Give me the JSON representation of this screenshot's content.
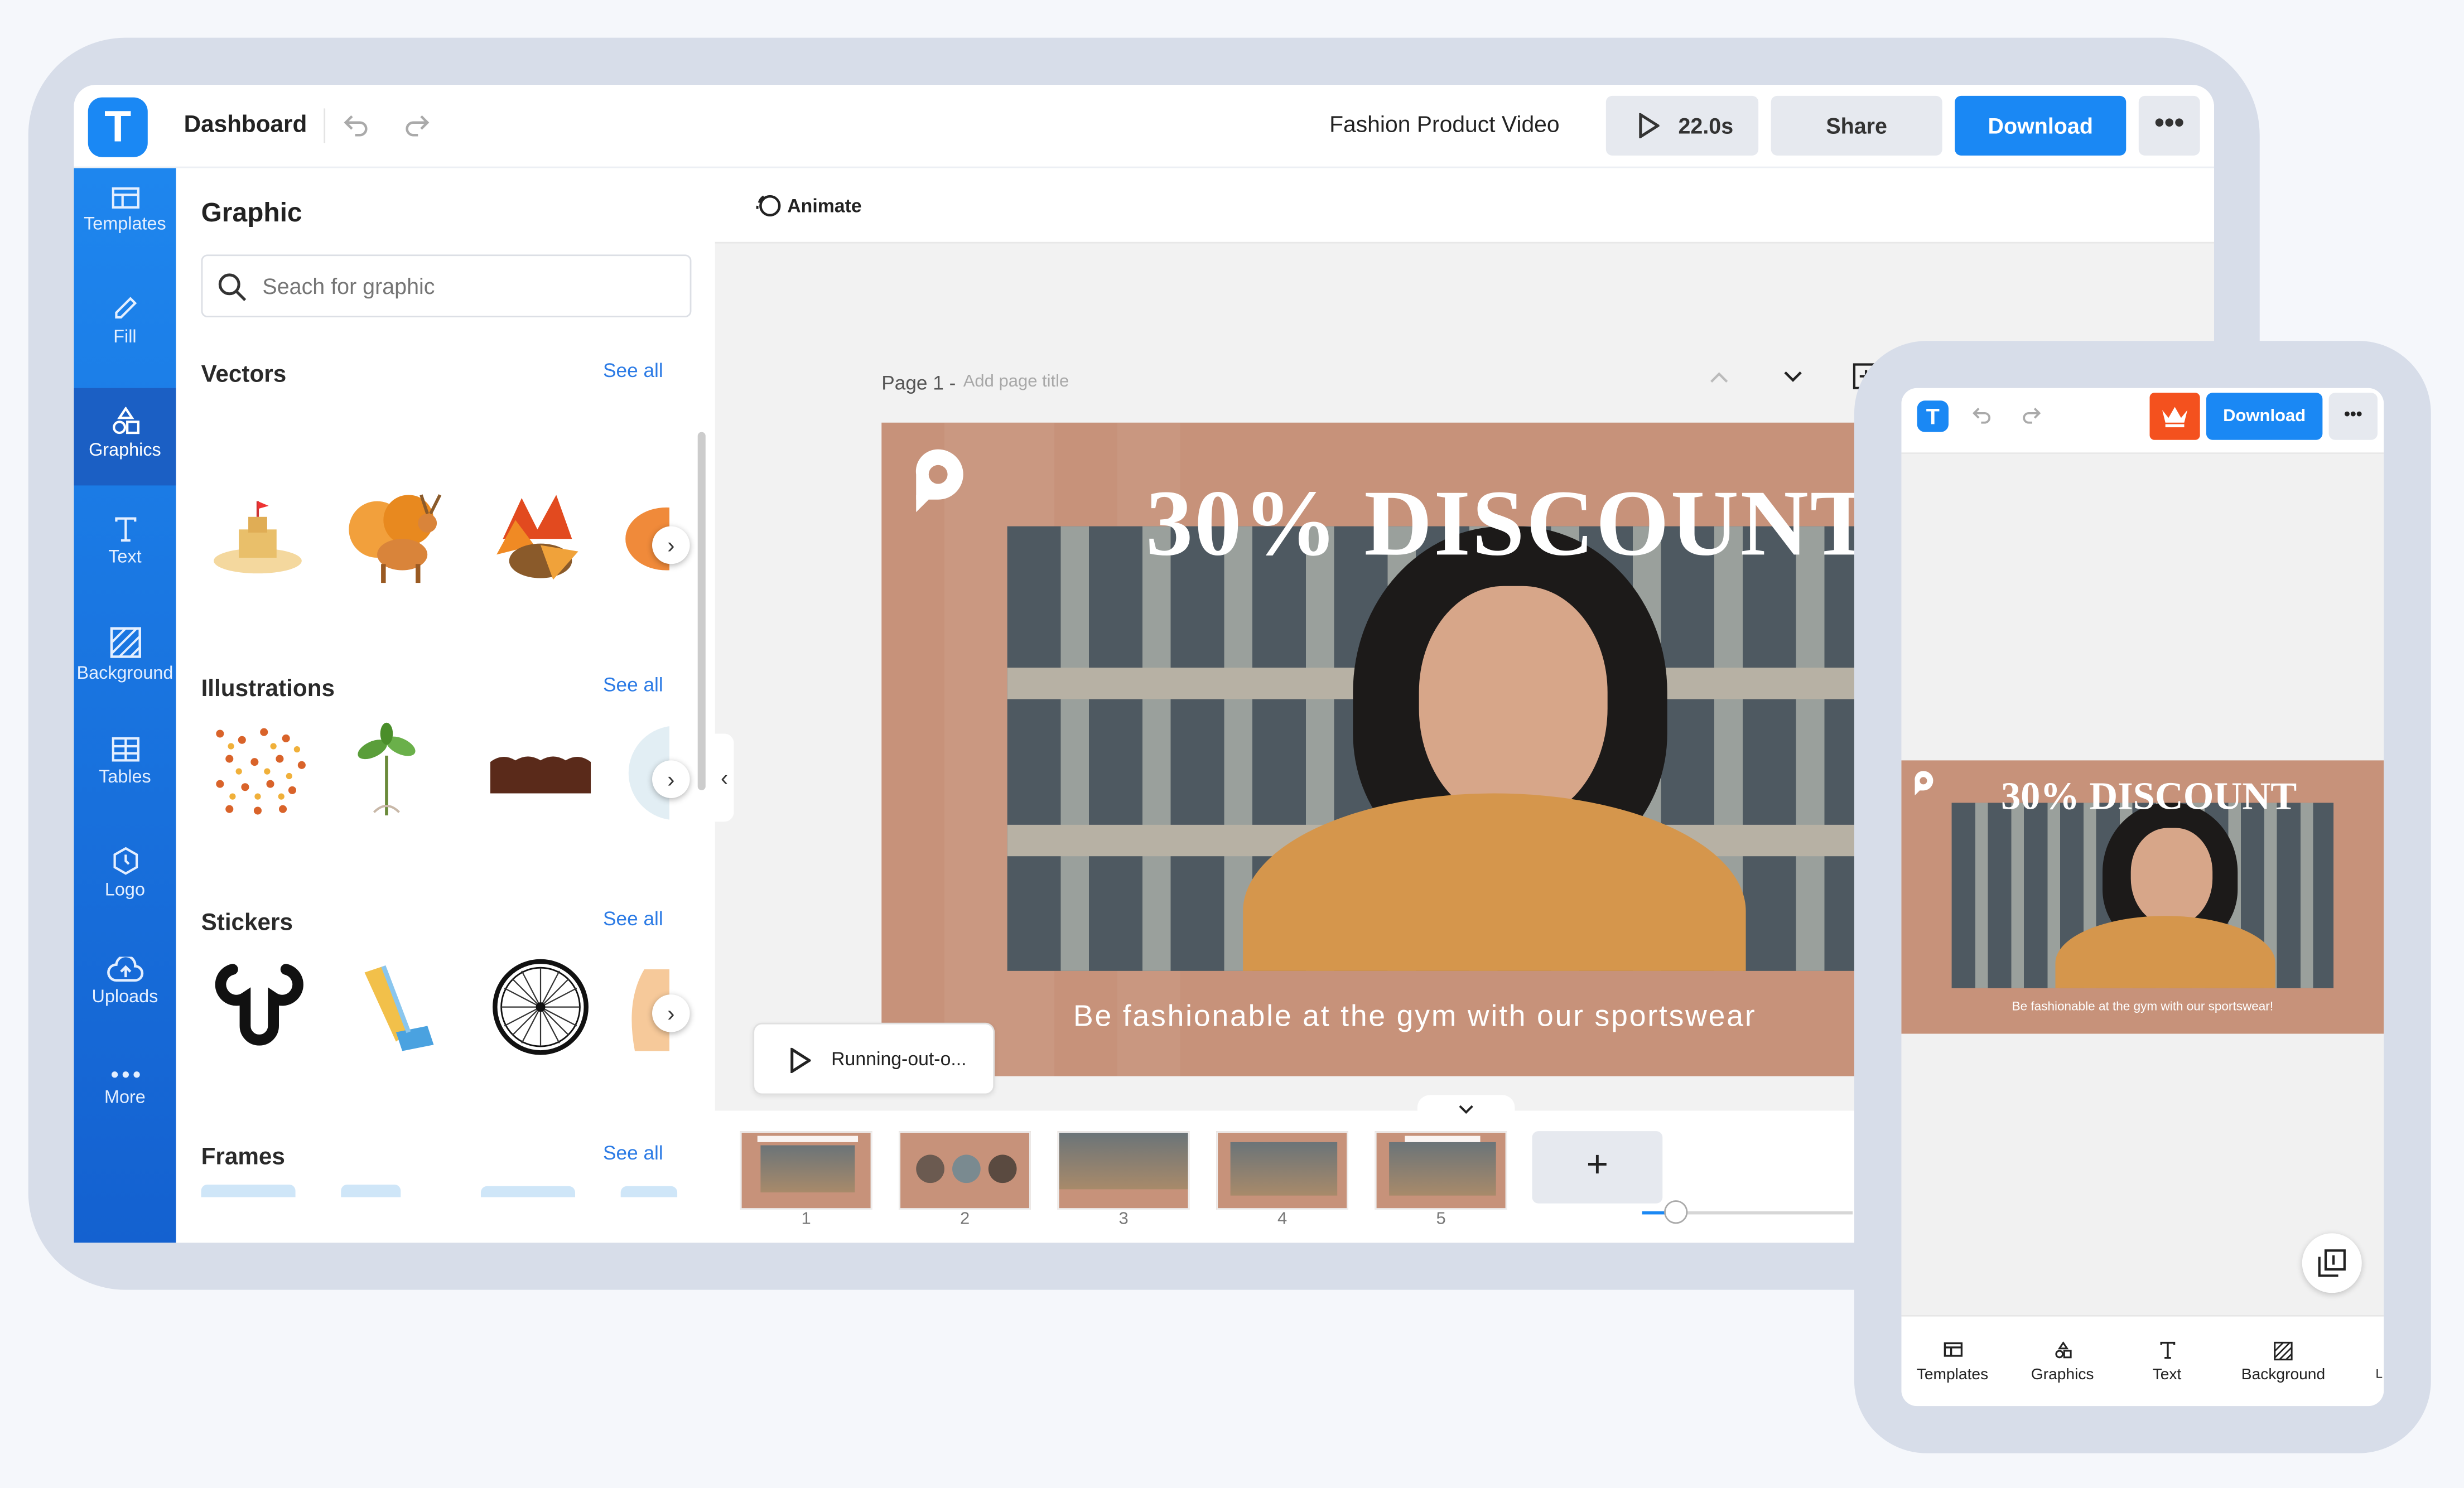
{
  "app": {
    "title": "Dashboard",
    "project": "Fashion Product Video",
    "duration": "22.0s",
    "share": "Share",
    "download": "Download",
    "logo_letter": "T"
  },
  "toolbar": {
    "animate": "Animate"
  },
  "sidebar": {
    "items": [
      {
        "label": "Templates",
        "icon": "templates-icon"
      },
      {
        "label": "Fill",
        "icon": "pencil-icon"
      },
      {
        "label": "Graphics",
        "icon": "shapes-icon"
      },
      {
        "label": "Text",
        "icon": "text-icon"
      },
      {
        "label": "Background",
        "icon": "background-icon"
      },
      {
        "label": "Tables",
        "icon": "table-icon"
      },
      {
        "label": "Logo",
        "icon": "logo-icon"
      },
      {
        "label": "Uploads",
        "icon": "upload-cloud-icon"
      },
      {
        "label": "More",
        "icon": "more-dots-icon"
      }
    ]
  },
  "panel": {
    "title": "Graphic",
    "search_placeholder": "Seach for graphic",
    "see_all": "See all",
    "sections": [
      {
        "title": "Vectors"
      },
      {
        "title": "Illustrations"
      },
      {
        "title": "Stickers"
      },
      {
        "title": "Frames"
      }
    ]
  },
  "page": {
    "label": "Page 1 -",
    "title_placeholder": "Add page title"
  },
  "canvas": {
    "headline": "30% DISCOUNT",
    "tagline": "Be fashionable at the gym with our sportswear",
    "audio": "Running-out-o..."
  },
  "timeline": {
    "pages": [
      "1",
      "2",
      "3",
      "4",
      "5"
    ],
    "add": "+"
  },
  "mobile": {
    "download": "Download",
    "headline": "30% DISCOUNT",
    "tagline": "Be fashionable at the gym with our sportswear!",
    "nav": [
      {
        "label": "Templates",
        "icon": "templates-icon"
      },
      {
        "label": "Graphics",
        "icon": "shapes-icon"
      },
      {
        "label": "Text",
        "icon": "text-icon"
      },
      {
        "label": "Background",
        "icon": "background-icon"
      }
    ],
    "nav_partial": "L"
  },
  "colors": {
    "accent": "#1a88f4",
    "download": "#1a88f4",
    "canvas_bg": "#c7927a",
    "crown": "#f4511e"
  }
}
